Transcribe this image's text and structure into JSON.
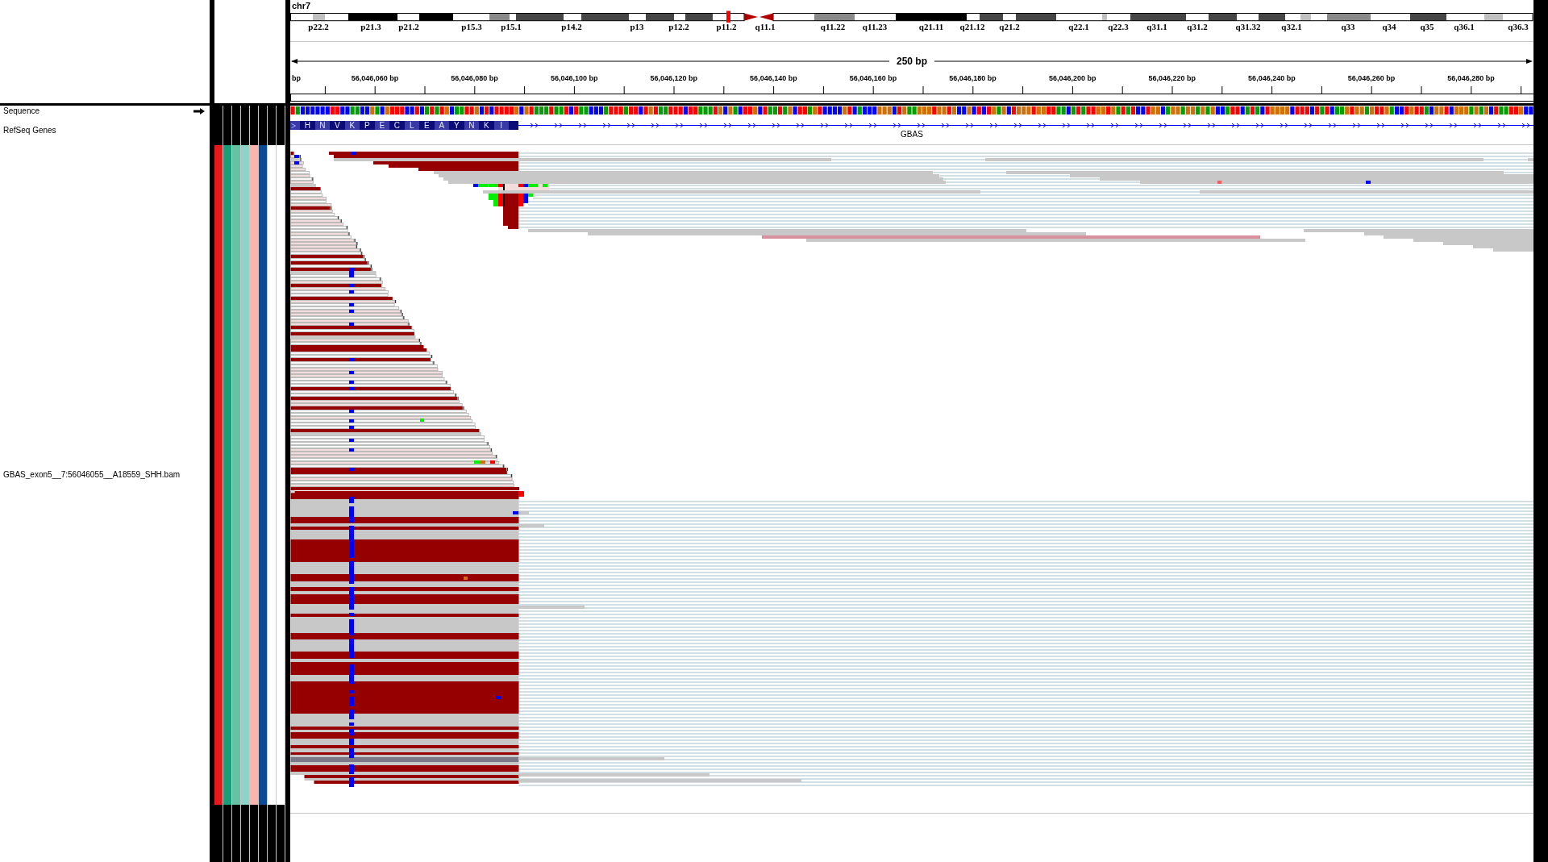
{
  "ideogram": {
    "chromosome": "chr7",
    "band_labels": [
      "p22.2",
      "p21.3",
      "p21.2",
      "p15.3",
      "p15.1",
      "p14.2",
      "p13",
      "p12.2",
      "p11.2",
      "q11.1",
      "q11.22",
      "q11.23",
      "q21.11",
      "q21.12",
      "q21.2",
      "q22.1",
      "q22.3",
      "q31.1",
      "q31.2",
      "q31.32",
      "q32.1",
      "q33",
      "q34",
      "q35",
      "q36.1",
      "q36.3"
    ]
  },
  "ruler": {
    "span": "250 bp",
    "tick_labels": [
      "bp",
      "56,046,060 bp",
      "56,046,080 bp",
      "56,046,100 bp",
      "56,046,120 bp",
      "56,046,140 bp",
      "56,046,160 bp",
      "56,046,180 bp",
      "56,046,200 bp",
      "56,046,220 bp",
      "56,046,240 bp",
      "56,046,260 bp",
      "56,046,280 bp"
    ]
  },
  "tracks": [
    {
      "kind": "sequence",
      "name": "Sequence"
    },
    {
      "kind": "gene",
      "name": "RefSeq Genes",
      "gene": "GBAS",
      "amino_acids": [
        "H",
        "N",
        "V",
        "K",
        "P",
        "E",
        "C",
        "L",
        "E",
        "A",
        "Y",
        "N",
        "K",
        "I"
      ]
    },
    {
      "kind": "alignment",
      "name": "GBAS_exon5__7:56046055__A18559_SHH.bam",
      "attributes": [
        {
          "color": "#e41a1c"
        },
        {
          "color": "#1b9e77"
        },
        {
          "color": "#66c2a5"
        },
        {
          "color": "#8dd3c7"
        },
        {
          "color": "#fbb4ae"
        },
        {
          "color": "#0b4a94"
        },
        {
          "color": "#ffffff"
        },
        {
          "color": "#ffffff"
        }
      ]
    }
  ]
}
